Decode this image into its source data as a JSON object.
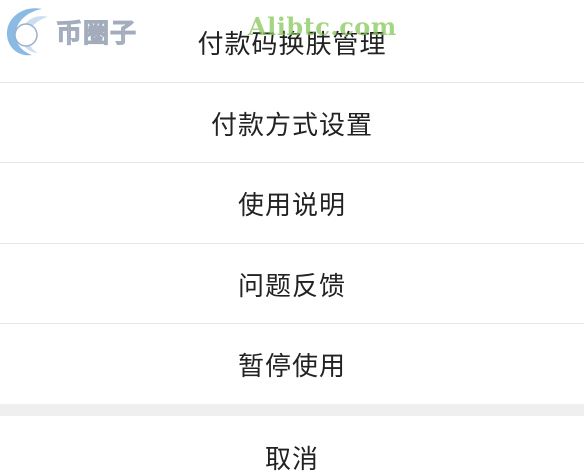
{
  "watermark": {
    "logo_text": "币圈子",
    "site_text": "Alibtc.com"
  },
  "menu": {
    "items": [
      {
        "label": "付款码换肤管理"
      },
      {
        "label": "付款方式设置"
      },
      {
        "label": "使用说明"
      },
      {
        "label": "问题反馈"
      },
      {
        "label": "暂停使用"
      }
    ],
    "cancel_label": "取消"
  },
  "colors": {
    "text": "#222222",
    "divider": "#e6e6e6",
    "gap": "#efefef",
    "watermark_green": "#86c85a"
  }
}
